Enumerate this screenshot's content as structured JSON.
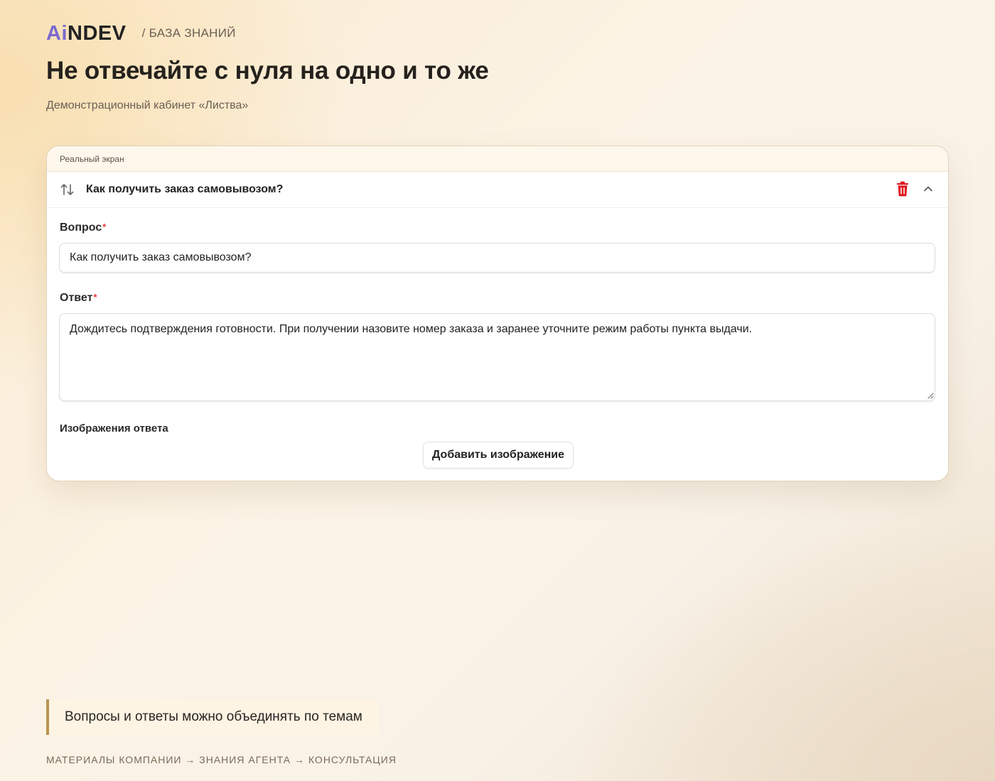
{
  "header": {
    "logo_ai": "Ai",
    "logo_rest": "NDEV",
    "breadcrumb": "/ БАЗА ЗНАНИЙ"
  },
  "page": {
    "title": "Не отвечайте с нуля на одно и то же",
    "subtitle": "Демонстрационный кабинет «Листва»"
  },
  "card": {
    "label": "Реальный экран",
    "item_title": "Как получить заказ самовывозом?",
    "icons": [
      "sort-arrows-icon",
      "trash-icon",
      "chevron-up-icon"
    ],
    "question_label": "Вопрос",
    "question_value": "Как получить заказ самовывозом?",
    "answer_label": "Ответ",
    "required_mark": "*",
    "answer_value": "Дождитесь подтверждения готовности. При получении назовите номер заказа и заранее уточните режим работы пункта выдачи.",
    "images_label": "Изображения ответа",
    "add_image_button": "Добавить изображение"
  },
  "note": "Вопросы и ответы можно объединять по темам",
  "flow": "МАТЕРИАЛЫ КОМПАНИИ → ЗНАНИЯ АГЕНТА → КОНСУЛЬТАЦИЯ",
  "colors": {
    "accent_logo": "#7a6ad0",
    "delete_red": "#e0141e",
    "required_red": "#e03a3a",
    "note_border": "#b8944f"
  }
}
